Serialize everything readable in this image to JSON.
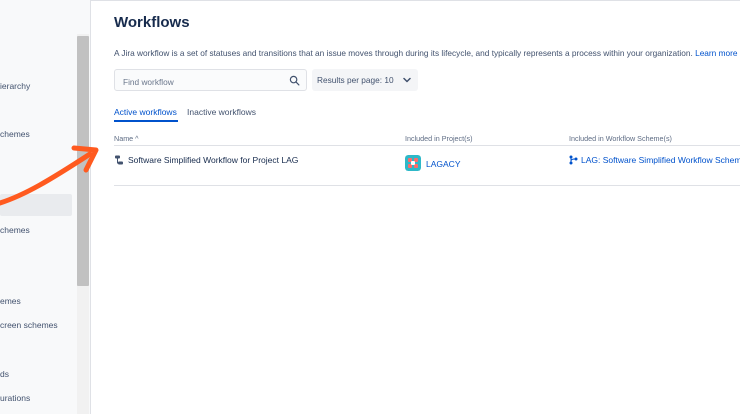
{
  "sidebar": {
    "items": [
      {
        "label": "ierarchy"
      },
      {
        "label": "chemes"
      },
      {
        "label": "chemes"
      },
      {
        "label": "emes"
      },
      {
        "label": "creen schemes"
      },
      {
        "label": "ds"
      },
      {
        "label": "urations"
      }
    ]
  },
  "page": {
    "title": "Workflows",
    "description": "A Jira workflow is a set of statuses and transitions that an issue moves through during its lifecycle, and typically represents a process within your organization.",
    "learn_more": "Learn more ab"
  },
  "search": {
    "placeholder": "Find workflow"
  },
  "results_per_page": {
    "label": "Results per page: 10"
  },
  "tabs": [
    {
      "label": "Active workflows",
      "active": true
    },
    {
      "label": "Inactive workflows",
      "active": false
    }
  ],
  "table": {
    "columns": [
      "Name ^",
      "Included in Project(s)",
      "Included in Workflow Scheme(s)"
    ],
    "rows": [
      {
        "name": "Software Simplified Workflow for Project LAG",
        "project": "LAGACY",
        "scheme": "LAG: Software Simplified Workflow Scheme"
      }
    ]
  },
  "colors": {
    "accent": "#0052cc",
    "annotation_arrow": "#ff5a1f"
  }
}
